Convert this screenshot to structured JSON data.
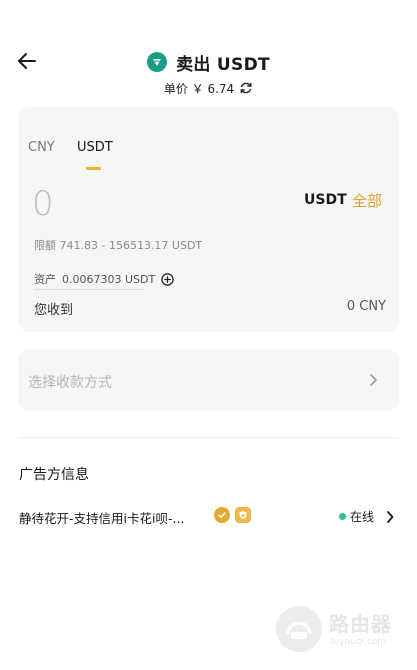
{
  "header": {
    "title": "卖出 USDT",
    "price": "单价 ￥ 6.74"
  },
  "tabs": [
    {
      "label": "CNY",
      "active": false
    },
    {
      "label": "USDT",
      "active": true
    }
  ],
  "order": {
    "amount": "0",
    "currency": "USDT",
    "all_label": "全部",
    "limit": "限额  741.83 - 156513.17 USDT",
    "asset_label": "资产",
    "asset_value": "0.0067303 USDT",
    "receive_label": "您收到",
    "receive_value": "0 CNY"
  },
  "payment": {
    "placeholder": "选择收款方式"
  },
  "advertiser": {
    "section_title": "广告方信息",
    "name": "静待花开-支持信用i卡花i呗-...",
    "status": "在线"
  },
  "watermark": {
    "brand": "路由器",
    "url": "luyouqi.com"
  },
  "colors": {
    "accent": "#e9b230",
    "online": "#2cc28b",
    "coin": "#1a9c87"
  },
  "icons": [
    "back-arrow-icon",
    "usdt-coin-icon",
    "refresh-icon",
    "plus-circle-icon",
    "chevron-right-icon",
    "verified-badge-icon",
    "shield-badge-icon"
  ]
}
